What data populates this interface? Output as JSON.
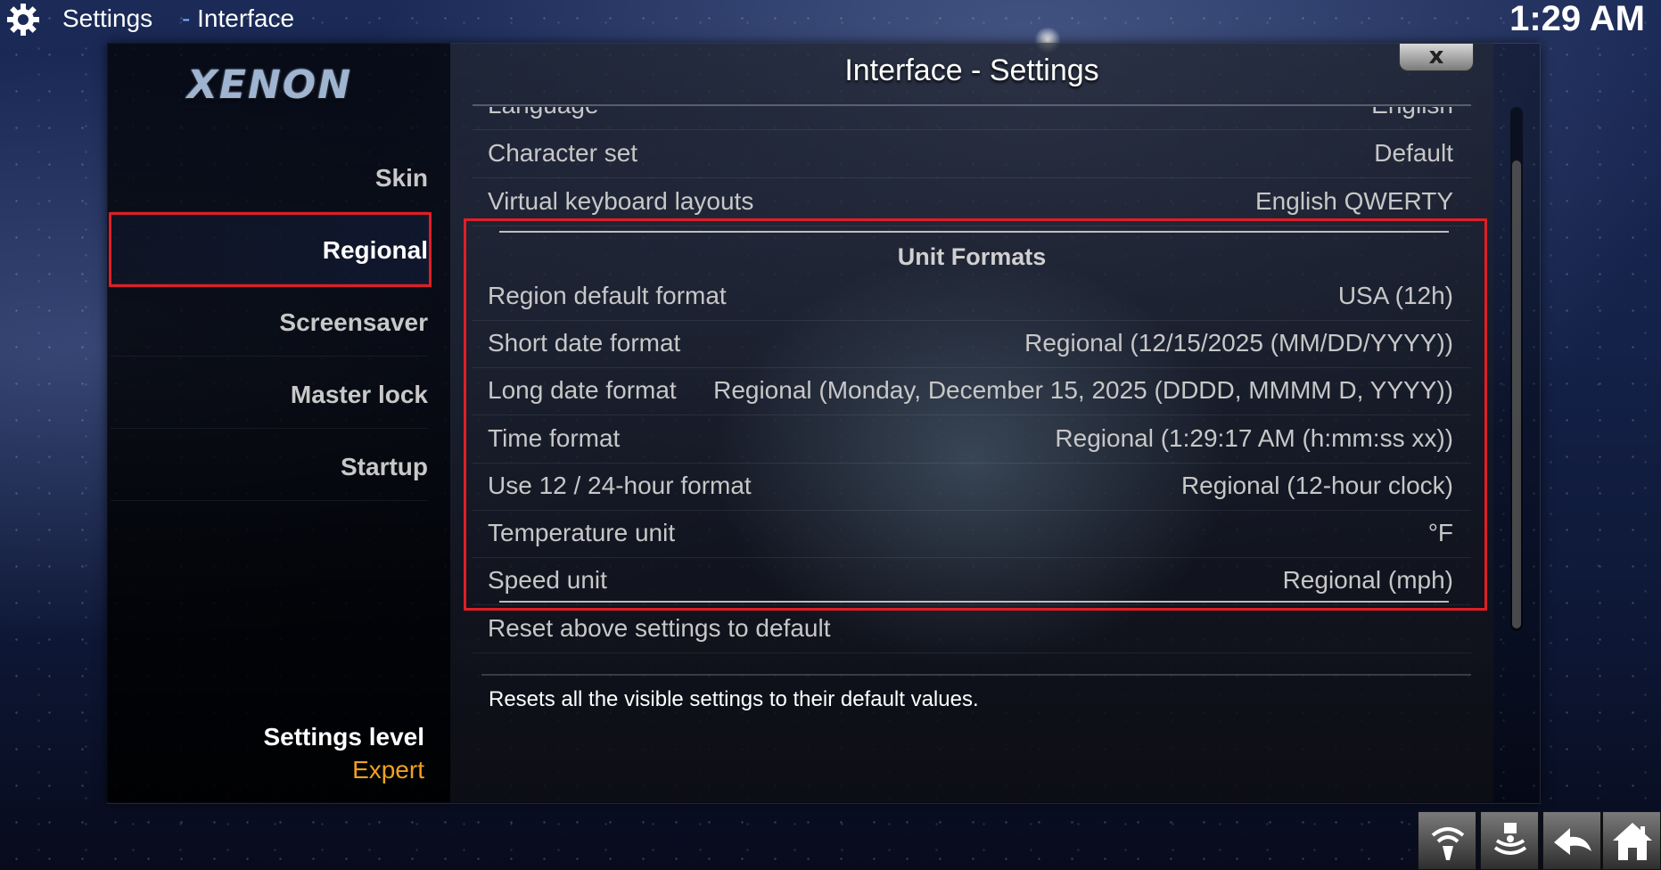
{
  "header": {
    "app": "Settings",
    "section_sep": "-",
    "section": "Interface",
    "clock": "1:29 AM"
  },
  "sidebar": {
    "logo": "XENON",
    "items": [
      {
        "label": "Skin"
      },
      {
        "label": "Regional"
      },
      {
        "label": "Screensaver"
      },
      {
        "label": "Master lock"
      },
      {
        "label": "Startup"
      }
    ],
    "active_index": 1,
    "settings_level_label": "Settings level",
    "settings_level_value": "Expert"
  },
  "dialog": {
    "title": "Interface - Settings",
    "close": "x"
  },
  "settings": {
    "language": {
      "label": "Language",
      "value": "English"
    },
    "charset": {
      "label": "Character set",
      "value": "Default"
    },
    "keyboard": {
      "label": "Virtual keyboard layouts",
      "value": "English QWERTY"
    },
    "group_title": "Unit Formats",
    "unit_rows": [
      {
        "label": "Region default format",
        "value": "USA (12h)"
      },
      {
        "label": "Short date format",
        "value": "Regional (12/15/2025 (MM/DD/YYYY))"
      },
      {
        "label": "Long date format",
        "value": "Regional (Monday, December 15, 2025 (DDDD, MMMM D, YYYY))"
      },
      {
        "label": "Time format",
        "value": "Regional (1:29:17 AM (h:mm:ss xx))"
      },
      {
        "label": "Use 12 / 24-hour format",
        "value": "Regional (12-hour clock)"
      },
      {
        "label": "Temperature unit",
        "value": "°F"
      },
      {
        "label": "Speed unit",
        "value": "Regional (mph)"
      }
    ],
    "reset": {
      "label": "Reset above settings to default"
    }
  },
  "description": "Resets all the visible settings to their default values.",
  "colors": {
    "highlight_border": "#e01e26",
    "settings_level_value": "#f0a020",
    "breadcrumb_dash": "#7aa6ff"
  },
  "bottom_buttons": [
    "network-icon",
    "eject-icon",
    "back-icon",
    "home-icon"
  ]
}
